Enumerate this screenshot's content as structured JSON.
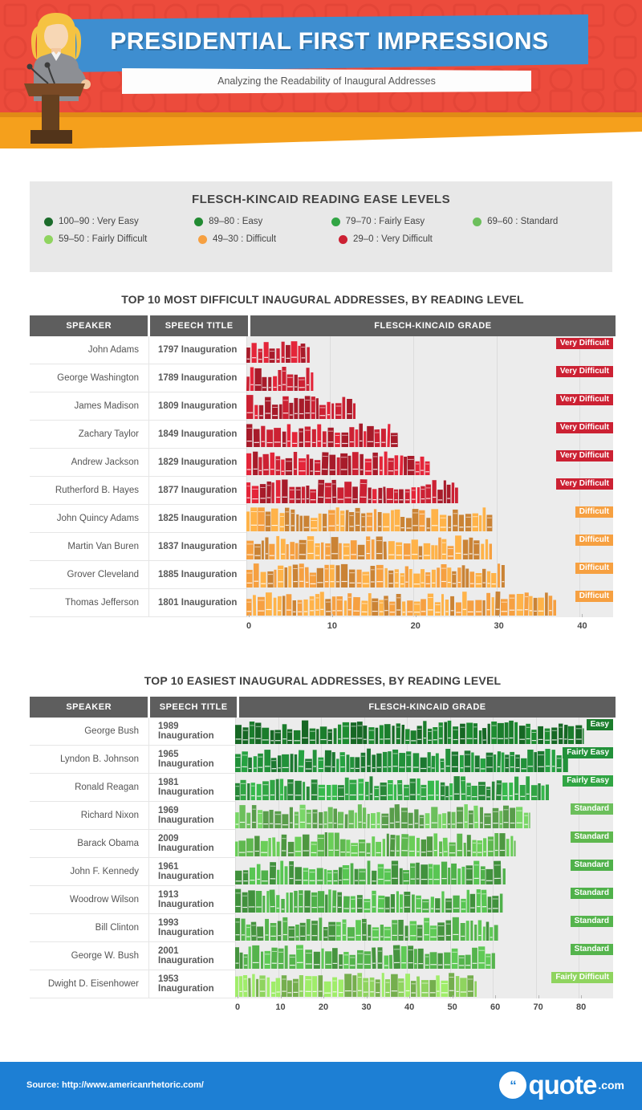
{
  "header": {
    "title": "PRESIDENTIAL FIRST IMPRESSIONS",
    "subtitle": "Analyzing the Readability of Inaugural Addresses",
    "colors": {
      "red": "#ec4b3c",
      "orange": "#f5a01c",
      "blue": "#3e8ed0"
    }
  },
  "legend": {
    "title": "FLESCH-KINCAID READING EASE LEVELS",
    "items": [
      {
        "label": "100–90 : Very Easy",
        "color": "#1b6b2b"
      },
      {
        "label": "89–80 : Easy",
        "color": "#228b33"
      },
      {
        "label": "79–70 : Fairly Easy",
        "color": "#31a544"
      },
      {
        "label": "69–60 : Standard",
        "color": "#6cbf5c"
      },
      {
        "label": "59–50 : Fairly Difficult",
        "color": "#8fd45f"
      },
      {
        "label": "49–30 : Difficult",
        "color": "#f6a041"
      },
      {
        "label": "29–0 : Very Difficult",
        "color": "#cc2133"
      }
    ]
  },
  "columns": {
    "speaker": "SPEAKER",
    "speech_title": "SPEECH TITLE",
    "grade": "FLESCH-KINCAID GRADE"
  },
  "chart_data": [
    {
      "type": "bar",
      "title": "TOP 10 MOST DIFFICULT INAUGURAL ADDRESSES, BY READING LEVEL",
      "xlabel": "FLESCH-KINCAID GRADE",
      "ylabel": "",
      "xlim": [
        0,
        44
      ],
      "xticks": [
        0,
        10,
        20,
        30,
        40
      ],
      "grid": true,
      "legend_position": "top",
      "orientation": "horizontal",
      "categories": [
        "John Adams",
        "George Washington",
        "James Madison",
        "Zachary Taylor",
        "Andrew Jackson",
        "Rutherford B. Hayes",
        "John Quincy Adams",
        "Martin Van Buren",
        "Grover Cleveland",
        "Thomas Jefferson"
      ],
      "values": [
        7.6,
        8.3,
        13.1,
        18.3,
        22.2,
        25.4,
        29.7,
        29.5,
        31.0,
        37.2
      ],
      "rows": [
        {
          "speaker": "John Adams",
          "speech": "1797 Inauguration",
          "value": 7.6,
          "band": "Very Difficult",
          "color": "#cc2133"
        },
        {
          "speaker": "George Washington",
          "speech": "1789 Inauguration",
          "value": 8.3,
          "band": "Very Difficult",
          "color": "#cc2133"
        },
        {
          "speaker": "James Madison",
          "speech": "1809 Inauguration",
          "value": 13.1,
          "band": "Very Difficult",
          "color": "#cc2133"
        },
        {
          "speaker": "Zachary Taylor",
          "speech": "1849 Inauguration",
          "value": 18.3,
          "band": "Very Difficult",
          "color": "#cc2133"
        },
        {
          "speaker": "Andrew Jackson",
          "speech": "1829 Inauguration",
          "value": 22.2,
          "band": "Very Difficult",
          "color": "#cc2133"
        },
        {
          "speaker": "Rutherford B. Hayes",
          "speech": "1877 Inauguration",
          "value": 25.4,
          "band": "Very Difficult",
          "color": "#cc2133"
        },
        {
          "speaker": "John Quincy Adams",
          "speech": "1825 Inauguration",
          "value": 29.7,
          "band": "Difficult",
          "color": "#f6a041"
        },
        {
          "speaker": "Martin Van Buren",
          "speech": "1837 Inauguration",
          "value": 29.5,
          "band": "Difficult",
          "color": "#f6a041"
        },
        {
          "speaker": "Grover Cleveland",
          "speech": "1885 Inauguration",
          "value": 31.0,
          "band": "Difficult",
          "color": "#f6a041"
        },
        {
          "speaker": "Thomas Jefferson",
          "speech": "1801 Inauguration",
          "value": 37.2,
          "band": "Difficult",
          "color": "#f6a041"
        }
      ]
    },
    {
      "type": "bar",
      "title": "TOP 10 EASIEST INAUGURAL ADDRESSES, BY READING LEVEL",
      "xlabel": "FLESCH-KINCAID GRADE",
      "ylabel": "",
      "xlim": [
        0,
        88
      ],
      "xticks": [
        0,
        10,
        20,
        30,
        40,
        50,
        60,
        70,
        80
      ],
      "grid": true,
      "legend_position": "top",
      "orientation": "horizontal",
      "categories": [
        "George Bush",
        "Lyndon B. Johnson",
        "Ronald Reagan",
        "Richard Nixon",
        "Barack Obama",
        "John F. Kennedy",
        "Woodrow Wilson",
        "Bill Clinton",
        "George W. Bush",
        "Dwight D. Eisenhower"
      ],
      "values": [
        81.2,
        77.5,
        73.1,
        68.7,
        65.3,
        63.3,
        62.6,
        61.2,
        60.5,
        56.3
      ],
      "rows": [
        {
          "speaker": "George Bush",
          "speech": "1989 Inauguration",
          "value": 81.2,
          "band": "Easy",
          "color": "#1b7d2c"
        },
        {
          "speaker": "Lyndon B. Johnson",
          "speech": "1965 Inauguration",
          "value": 77.5,
          "band": "Fairly Easy",
          "color": "#22913a"
        },
        {
          "speaker": "Ronald Reagan",
          "speech": "1981 Inauguration",
          "value": 73.1,
          "band": "Fairly Easy",
          "color": "#31a544"
        },
        {
          "speaker": "Richard Nixon",
          "speech": "1969 Inauguration",
          "value": 68.7,
          "band": "Standard",
          "color": "#6cbf5c"
        },
        {
          "speaker": "Barack Obama",
          "speech": "2009 Inauguration",
          "value": 65.3,
          "band": "Standard",
          "color": "#5fb84f"
        },
        {
          "speaker": "John F. Kennedy",
          "speech": "1961 Inauguration",
          "value": 63.3,
          "band": "Standard",
          "color": "#4fb14a"
        },
        {
          "speaker": "Woodrow Wilson",
          "speech": "1913 Inauguration",
          "value": 62.6,
          "band": "Standard",
          "color": "#4fb14a"
        },
        {
          "speaker": "Bill Clinton",
          "speech": "1993 Inauguration",
          "value": 61.2,
          "band": "Standard",
          "color": "#55b44d"
        },
        {
          "speaker": "George W. Bush",
          "speech": "2001 Inauguration",
          "value": 60.5,
          "band": "Standard",
          "color": "#55b44d"
        },
        {
          "speaker": "Dwight D. Eisenhower",
          "speech": "1953 Inauguration",
          "value": 56.3,
          "band": "Fairly Difficult",
          "color": "#8fd45f"
        }
      ]
    }
  ],
  "footer": {
    "source": "Source: http://www.americanrhetoric.com/",
    "logo_word": "quote",
    "logo_tld": ".com",
    "logo_mark": "“"
  }
}
